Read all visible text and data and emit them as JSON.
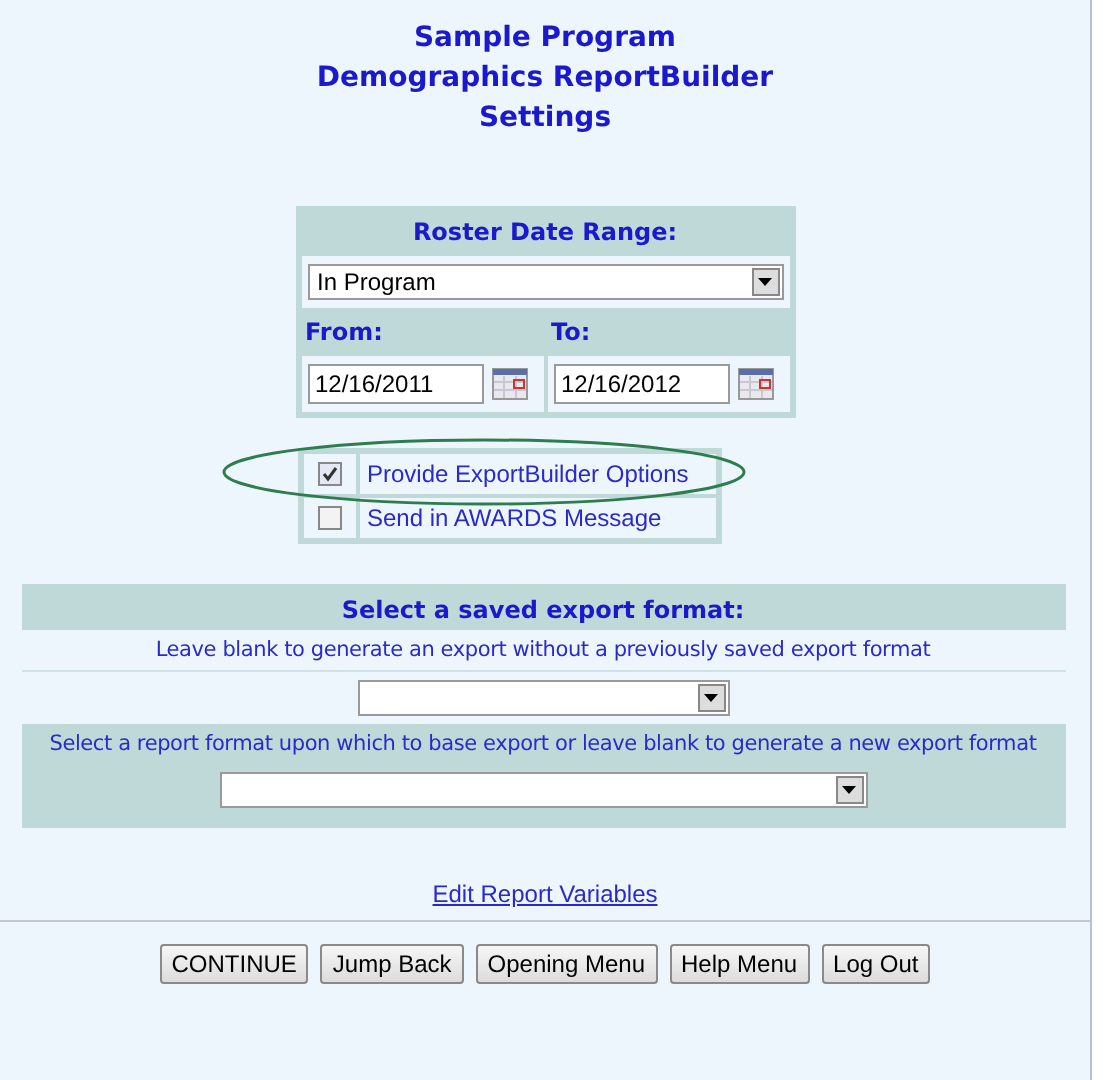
{
  "title_lines": [
    "Sample Program",
    "Demographics ReportBuilder",
    "Settings"
  ],
  "roster": {
    "heading": "Roster Date Range:",
    "range_value": "In Program",
    "from_label": "From:",
    "to_label": "To:",
    "from_value": "12/16/2011",
    "to_value": "12/16/2012"
  },
  "options": [
    {
      "label": "Provide ExportBuilder Options",
      "checked": true,
      "highlighted": true
    },
    {
      "label": "Send in AWARDS Message",
      "checked": false,
      "highlighted": false
    }
  ],
  "export": {
    "heading": "Select a saved export format:",
    "hint_1": "Leave blank to generate an export without a previously saved export format",
    "hint_2": "Select a report format upon which to base export or leave blank to generate a new export format"
  },
  "link": "Edit Report Variables",
  "buttons": [
    "CONTINUE",
    "Jump Back",
    "Opening Menu",
    "Help Menu",
    "Log Out"
  ]
}
